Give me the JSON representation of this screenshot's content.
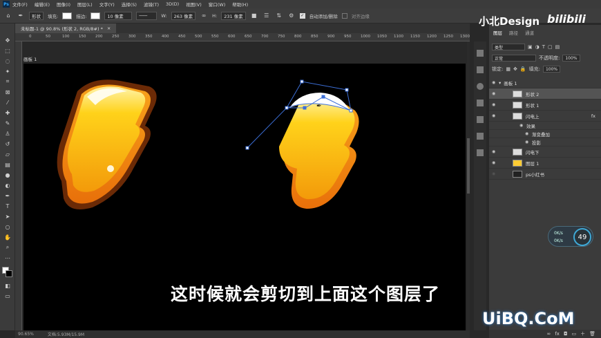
{
  "menubar": {
    "logo": "Ps",
    "items": [
      "文件(F)",
      "编辑(E)",
      "图像(I)",
      "图层(L)",
      "文字(Y)",
      "选择(S)",
      "滤镜(T)",
      "3D(D)",
      "视图(V)",
      "窗口(W)",
      "帮助(H)"
    ]
  },
  "options": {
    "mode": "形状",
    "fill_label": "填充:",
    "stroke_label": "描边:",
    "stroke_width": "10 像素",
    "w_label": "W:",
    "w_value": "263 像素",
    "h_label": "H:",
    "h_value": "231 像素",
    "auto_add_delete": "自动添加/删除",
    "align_edges": "对齐边缘"
  },
  "document": {
    "tab_title": "未标题-1 @ 90.8% (形状 2, RGB/8#) *",
    "artboard_label": "画板 1",
    "ruler_ticks": [
      "0",
      "50",
      "100",
      "150",
      "200",
      "250",
      "300",
      "350",
      "400",
      "450",
      "500",
      "550",
      "600",
      "650",
      "700",
      "750",
      "800",
      "850",
      "900",
      "950",
      "1000",
      "1050",
      "1100",
      "1150",
      "1200",
      "1250",
      "1300"
    ]
  },
  "status": {
    "zoom": "90.65%",
    "doc": "文档:5.93M/15.9M"
  },
  "panel": {
    "tabs": [
      "图层",
      "路径",
      "通道"
    ],
    "filter": "类型",
    "blend_mode": "正常",
    "opacity_label": "不透明度:",
    "opacity_value": "100%",
    "lock_label": "锁定:",
    "fill_label": "填充:",
    "fill_value": "100%",
    "layers": [
      {
        "name": "画板 1",
        "indent": 0
      },
      {
        "name": "形状 2",
        "indent": 1
      },
      {
        "name": "形状 1",
        "indent": 1
      },
      {
        "name": "闪电上",
        "indent": 1
      },
      {
        "name": "效果",
        "indent": 2
      },
      {
        "name": "渐变叠加",
        "indent": 3
      },
      {
        "name": "投影",
        "indent": 3
      },
      {
        "name": "闪电下",
        "indent": 1
      },
      {
        "name": "图层 1",
        "indent": 1
      },
      {
        "name": "ps小红书",
        "indent": 1
      }
    ]
  },
  "overlay": {
    "brand": "小北Design",
    "bilibili": "bilibili",
    "subtitle": "这时候就会剪切到上面这个图层了",
    "site": "UiBQ.CoM",
    "speed_pct": "49",
    "speed_up": "0K/s",
    "speed_down": "0K/s"
  },
  "colors": {
    "bolt_yellow": "#ffcc00",
    "bolt_orange": "#f08a1c",
    "path_blue": "#3c6fd8"
  }
}
